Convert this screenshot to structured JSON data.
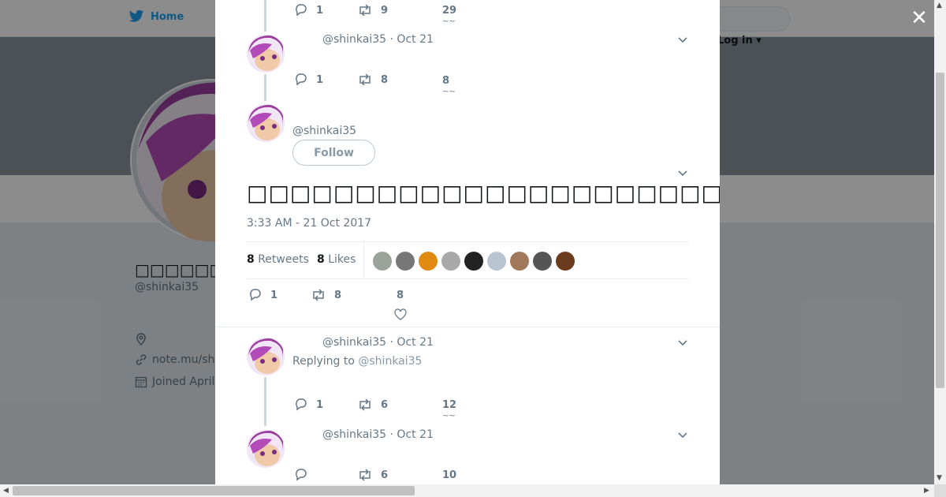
{
  "nav": {
    "home_label": "Home",
    "login_label": "Log in"
  },
  "profile": {
    "name": "□□□□□□□□□",
    "handle": "@shinkai35",
    "link": "note.mu/sh",
    "joined": "Joined April"
  },
  "tweets": [
    {
      "reply_count": "1",
      "retweet_count": "9",
      "like_count": "29"
    },
    {
      "handle": "@shinkai35 · Oct 21",
      "reply_count": "1",
      "retweet_count": "8",
      "like_count": "8"
    }
  ],
  "main_tweet": {
    "handle": "@shinkai35",
    "follow_label": "Follow",
    "text": "□□□□□□□□□□□□□□□□□□□□□□□□□□□□□□□□□□□□□□□□□□□□□□□□□□□□□□□□□□□□",
    "timestamp": "3:33 AM - 21 Oct 2017",
    "retweets_num": "8",
    "retweets_label": "Retweets",
    "likes_num": "8",
    "likes_label": "Likes",
    "reply_count": "1",
    "retweet_count": "8",
    "like_count": "8"
  },
  "replies": [
    {
      "handle": "@shinkai35 · Oct 21",
      "replying_prefix": "Replying to",
      "replying_to": "@shinkai35",
      "reply_count": "1",
      "retweet_count": "6",
      "like_count": "12"
    },
    {
      "handle": "@shinkai35 · Oct 21",
      "retweet_count": "6",
      "like_count": "10"
    }
  ],
  "colors": {
    "brand": "#1da1f2",
    "muted": "#657786",
    "overlay": "rgba(0,0,0,0.45)"
  },
  "liker_colors": [
    "#9aa39a",
    "#777777",
    "#e08a10",
    "#a9a9a9",
    "#222222",
    "#b8c4d0",
    "#a0785a",
    "#555555",
    "#6b3b1f"
  ]
}
